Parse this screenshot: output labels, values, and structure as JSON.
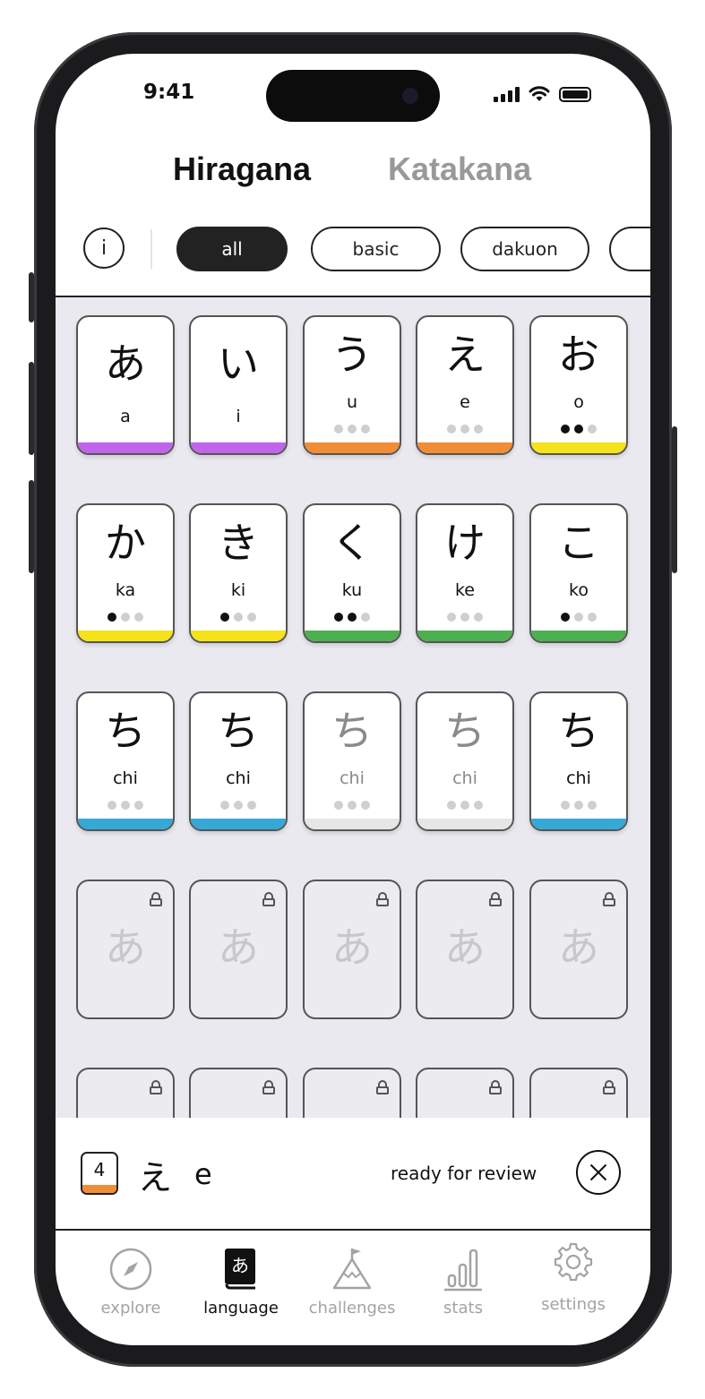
{
  "status_bar": {
    "time": "9:41"
  },
  "tabs": [
    {
      "label": "Hiragana",
      "active": true
    },
    {
      "label": "Katakana",
      "active": false
    }
  ],
  "filters": {
    "info_label": "i",
    "chips": [
      {
        "label": "all",
        "active": true
      },
      {
        "label": "basic",
        "active": false
      },
      {
        "label": "dakuon",
        "active": false
      },
      {
        "label": "",
        "active": false
      }
    ]
  },
  "colors": {
    "purple": "#c065ea",
    "orange": "#f18c37",
    "yellow": "#f4e21a",
    "green": "#4caf50",
    "blue": "#35a8d8",
    "grey": "#e6e6e6"
  },
  "cards": [
    {
      "kana": "あ",
      "romaji": "a",
      "progress": 0,
      "color": "#c065ea",
      "show_dots": false
    },
    {
      "kana": "い",
      "romaji": "i",
      "progress": 0,
      "color": "#c065ea",
      "show_dots": false
    },
    {
      "kana": "う",
      "romaji": "u",
      "progress": 0,
      "color": "#f18c37",
      "show_dots": true
    },
    {
      "kana": "え",
      "romaji": "e",
      "progress": 0,
      "color": "#f18c37",
      "show_dots": true
    },
    {
      "kana": "お",
      "romaji": "o",
      "progress": 2,
      "color": "#f4e21a",
      "show_dots": true
    },
    {
      "kana": "か",
      "romaji": "ka",
      "progress": 1,
      "color": "#f4e21a",
      "show_dots": true
    },
    {
      "kana": "き",
      "romaji": "ki",
      "progress": 1,
      "color": "#f4e21a",
      "show_dots": true
    },
    {
      "kana": "く",
      "romaji": "ku",
      "progress": 2,
      "color": "#4caf50",
      "show_dots": true
    },
    {
      "kana": "け",
      "romaji": "ke",
      "progress": 0,
      "color": "#4caf50",
      "show_dots": true
    },
    {
      "kana": "こ",
      "romaji": "ko",
      "progress": 1,
      "color": "#4caf50",
      "show_dots": true
    },
    {
      "kana": "ち",
      "romaji": "chi",
      "progress": 0,
      "color": "#35a8d8",
      "show_dots": true
    },
    {
      "kana": "ち",
      "romaji": "chi",
      "progress": 0,
      "color": "#35a8d8",
      "show_dots": true
    },
    {
      "kana": "ち",
      "romaji": "chi",
      "progress": 0,
      "color": "#e6e6e6",
      "show_dots": true,
      "faded": true
    },
    {
      "kana": "ち",
      "romaji": "chi",
      "progress": 0,
      "color": "#e6e6e6",
      "show_dots": true,
      "faded": true
    },
    {
      "kana": "ち",
      "romaji": "chi",
      "progress": 0,
      "color": "#35a8d8",
      "show_dots": true
    }
  ],
  "locked_cards": [
    {
      "kana": "あ"
    },
    {
      "kana": "あ"
    },
    {
      "kana": "あ"
    },
    {
      "kana": "あ"
    },
    {
      "kana": "あ"
    },
    {
      "kana": ""
    },
    {
      "kana": ""
    },
    {
      "kana": ""
    },
    {
      "kana": ""
    },
    {
      "kana": ""
    }
  ],
  "detail": {
    "level": "4",
    "level_color": "#f18c37",
    "kana": "え",
    "romaji": "e",
    "status": "ready for review"
  },
  "nav": [
    {
      "label": "explore",
      "icon": "compass-icon",
      "active": false
    },
    {
      "label": "language",
      "icon": "language-book-icon",
      "active": true
    },
    {
      "label": "challenges",
      "icon": "mountain-flag-icon",
      "active": false
    },
    {
      "label": "stats",
      "icon": "bar-chart-icon",
      "active": false
    },
    {
      "label": "settings",
      "icon": "gear-icon",
      "active": false
    }
  ]
}
